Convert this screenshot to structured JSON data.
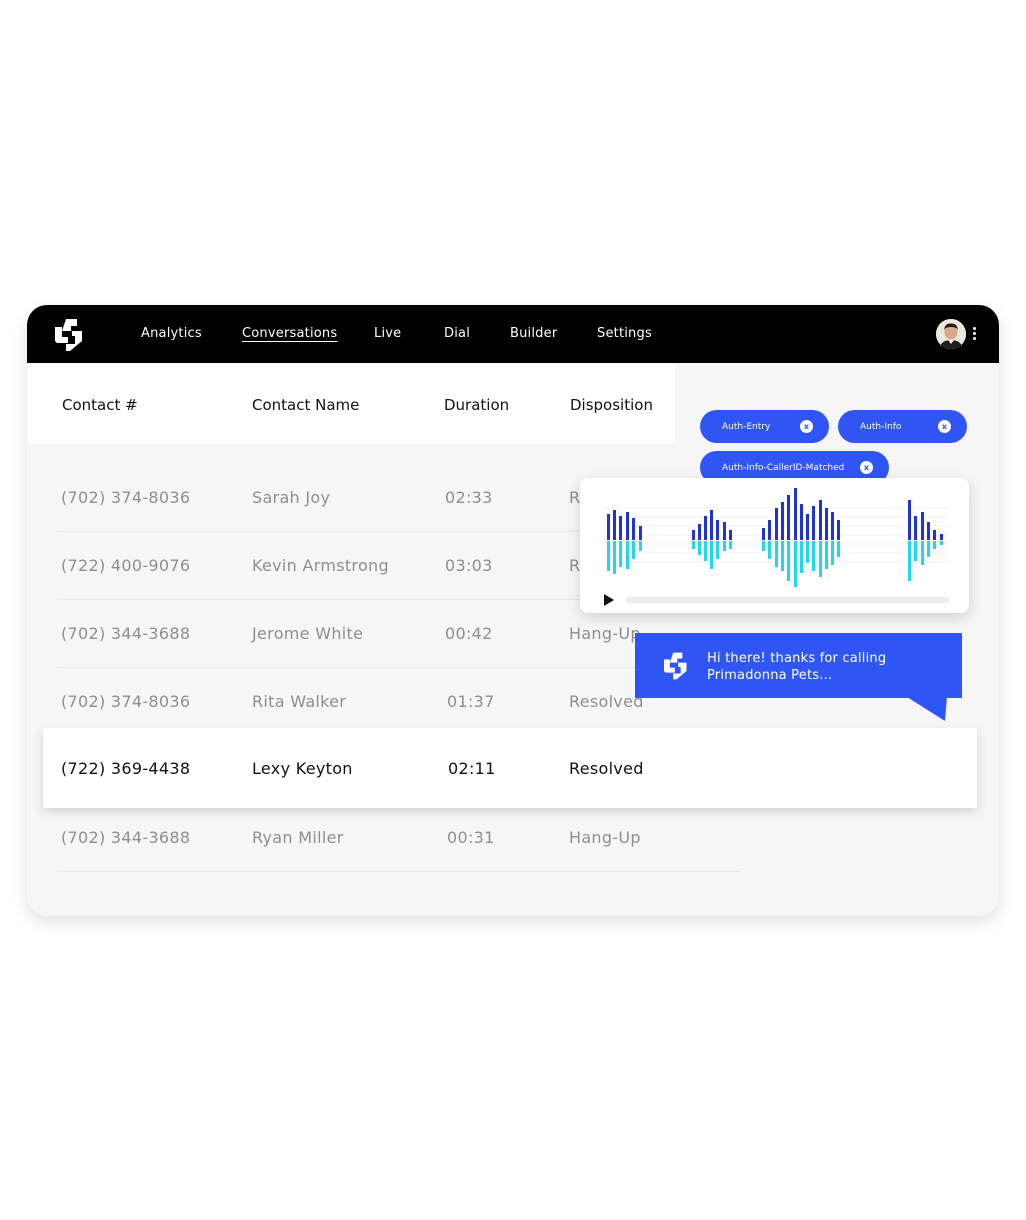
{
  "nav": {
    "items": [
      {
        "label": "Analytics"
      },
      {
        "label": "Conversations",
        "active": true
      },
      {
        "label": "Live"
      },
      {
        "label": "Dial"
      },
      {
        "label": "Builder"
      },
      {
        "label": "Settings"
      }
    ],
    "logo_icon": "brand-logo-icon",
    "menu_icon": "kebab-menu-icon"
  },
  "table": {
    "headers": [
      "Contact #",
      "Contact Name",
      "Duration",
      "Disposition"
    ],
    "rows": [
      {
        "contact": "(702) 374-8036",
        "name": "Sarah Joy",
        "duration": "02:33",
        "disposition": "R"
      },
      {
        "contact": "(722) 400-9076",
        "name": "Kevin Armstrong",
        "duration": "03:03",
        "disposition": "R"
      },
      {
        "contact": "(702) 344-3688",
        "name": "Jerome White",
        "duration": "00:42",
        "disposition": "Hang-Up"
      },
      {
        "contact": "(702) 374-8036",
        "name": "Rita Walker",
        "duration": "01:37",
        "disposition": "Resolved"
      },
      {
        "contact": "(722) 369-4438",
        "name": "Lexy Keyton",
        "duration": "02:11",
        "disposition": "Resolved",
        "selected": true
      },
      {
        "contact": "(702) 344-3688",
        "name": "Ryan Miller",
        "duration": "00:31",
        "disposition": "Hang-Up"
      }
    ]
  },
  "tags": [
    {
      "label": "Auth-Entry",
      "remove": "x"
    },
    {
      "label": "Auth-Info",
      "remove": "x"
    },
    {
      "label": "Auth-Info-CallerID-Matched",
      "remove": "x"
    }
  ],
  "audio_player": {
    "play_icon": "play-icon",
    "progress": 0,
    "colors": {
      "top": "#2233d6",
      "bottom": "#22d6ee"
    }
  },
  "chat": {
    "message_line1": "Hi there! thanks for calling",
    "message_line2": "Primadonna Pets..."
  },
  "colors": {
    "accent": "#2f55f4",
    "nav_bg": "#000000",
    "panel_bg": "#f6f6f6"
  }
}
